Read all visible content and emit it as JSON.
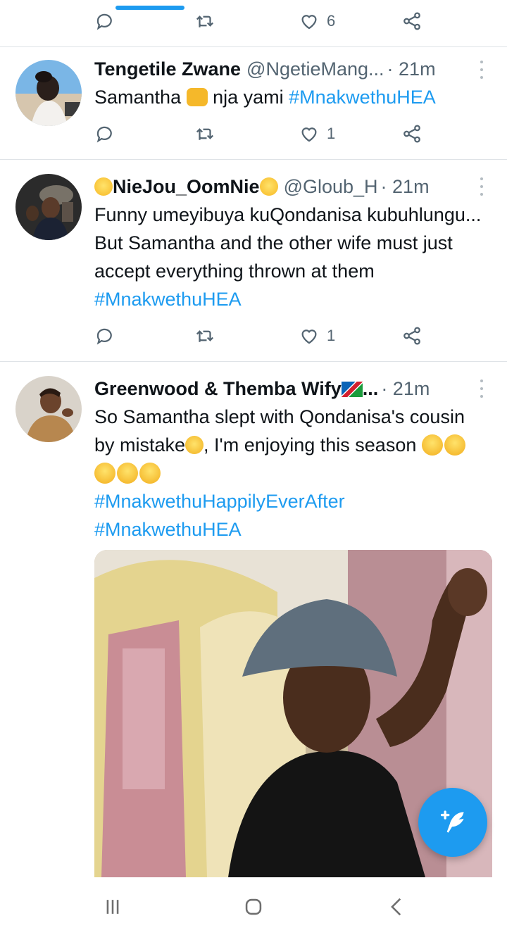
{
  "icons": {
    "reply": "reply-icon",
    "retweet": "retweet-icon",
    "like": "heart-icon",
    "share": "share-icon",
    "more": "more-vertical-icon",
    "compose": "compose-feather-icon",
    "nav_recent": "recent-apps-icon",
    "nav_home": "home-icon",
    "nav_back": "back-icon"
  },
  "colors": {
    "accent": "#1d9bf0",
    "muted": "#536471",
    "text": "#0f1419",
    "divider": "#dfe3e7"
  },
  "previous_tweet": {
    "likes": "6"
  },
  "tweets": [
    {
      "name": "Tengetile Zwane",
      "handle": "@NgetieMang...",
      "time": "· 21m",
      "text_1": "Samantha ",
      "text_2": " nja yami ",
      "hashtag": "#MnakwethuHEA",
      "likes": "1"
    },
    {
      "name": "NieJou_OomNie",
      "handle": "@Gloub_H",
      "time": "· 21m",
      "text": "Funny umeyibuya kuQondanisa kubuhlungu... But Samantha and the other wife must just accept everything thrown at them ",
      "hashtag": "#MnakwethuHEA",
      "likes": "1"
    },
    {
      "name": "Greenwood & Themba Wify",
      "name_suffix": "...",
      "time": "· 21m",
      "text_1": "So Samantha slept with Qondanisa's cousin by mistake",
      "text_2": ", I'm enjoying this season ",
      "hashtag_1": "#MnakwethuHappilyEverAfter",
      "hashtag_2": "#MnakwethuHEA"
    }
  ]
}
